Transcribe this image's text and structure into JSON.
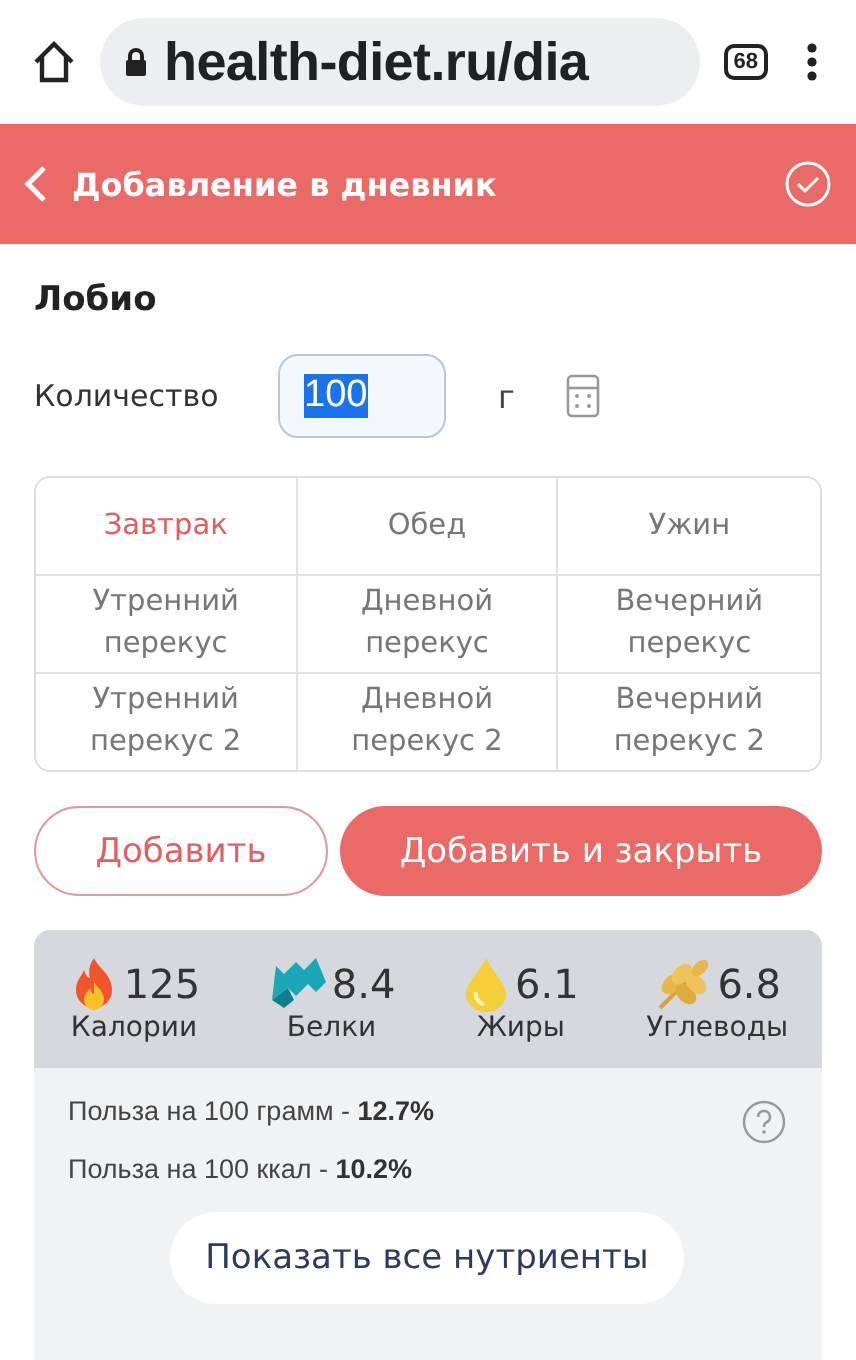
{
  "browser": {
    "url": "health-diet.ru/dia",
    "tab_count": "68"
  },
  "header": {
    "title": "Добавление в дневник"
  },
  "food": {
    "name": "Лобио"
  },
  "quantity": {
    "label": "Количество",
    "value": "100",
    "unit": "г"
  },
  "meals": [
    {
      "label": "Завтрак",
      "selected": true
    },
    {
      "label": "Обед",
      "selected": false
    },
    {
      "label": "Ужин",
      "selected": false
    },
    {
      "label": "Утренний перекус",
      "selected": false
    },
    {
      "label": "Дневной перекус",
      "selected": false
    },
    {
      "label": "Вечерний перекус",
      "selected": false
    },
    {
      "label": "Утренний перекус 2",
      "selected": false
    },
    {
      "label": "Дневной перекус 2",
      "selected": false
    },
    {
      "label": "Вечерний перекус 2",
      "selected": false
    }
  ],
  "buttons": {
    "add": "Добавить",
    "add_close": "Добавить и закрыть"
  },
  "nutrients": [
    {
      "kind": "flame",
      "value": "125",
      "label": "Калории"
    },
    {
      "kind": "protein",
      "value": "8.4",
      "label": "Белки"
    },
    {
      "kind": "drop",
      "value": "6.1",
      "label": "Жиры"
    },
    {
      "kind": "grain",
      "value": "6.8",
      "label": "Углеводы"
    }
  ],
  "benefits": [
    "Польза на 100 грамм - **12.7%**",
    "Польза на 100 ккал - **10.2%**"
  ],
  "show_all": "Показать все нутриенты"
}
